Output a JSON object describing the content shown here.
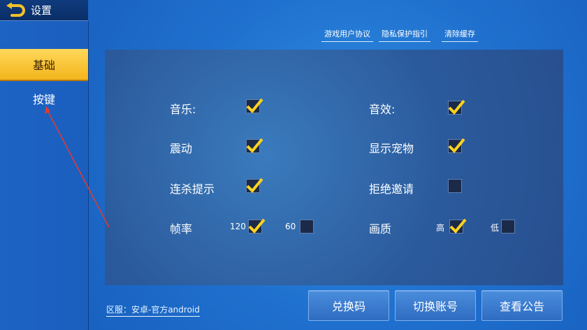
{
  "header": {
    "title": "设置",
    "back_icon": "back-arrow-icon"
  },
  "sidebar": {
    "items": [
      {
        "label": "基础",
        "active": true
      },
      {
        "label": "按键",
        "active": false
      }
    ]
  },
  "top_links": {
    "user_agreement": "游戏用户协议",
    "privacy": "隐私保护指引",
    "clear_cache": "清除缓存"
  },
  "settings": {
    "music": {
      "label": "音乐:",
      "checked": true
    },
    "sound": {
      "label": "音效:",
      "checked": true
    },
    "vibration": {
      "label": "震动",
      "checked": true
    },
    "show_pet": {
      "label": "显示宠物",
      "checked": true
    },
    "kill_streak": {
      "label": "连杀提示",
      "checked": true
    },
    "reject_invite": {
      "label": "拒绝邀请",
      "checked": false
    },
    "frame_rate": {
      "label": "帧率",
      "opt_120": "120",
      "opt_120_checked": true,
      "opt_60": "60",
      "opt_60_checked": false
    },
    "quality": {
      "label": "画质",
      "opt_high": "高",
      "opt_high_checked": true,
      "opt_low": "低",
      "opt_low_checked": false
    }
  },
  "footer": {
    "server": "区服：安卓-官方android",
    "redeem": "兑换码",
    "switch_account": "切换账号",
    "notice": "查看公告"
  },
  "colors": {
    "accent_yellow": "#f7c531",
    "check_yellow": "#ffd21f"
  }
}
